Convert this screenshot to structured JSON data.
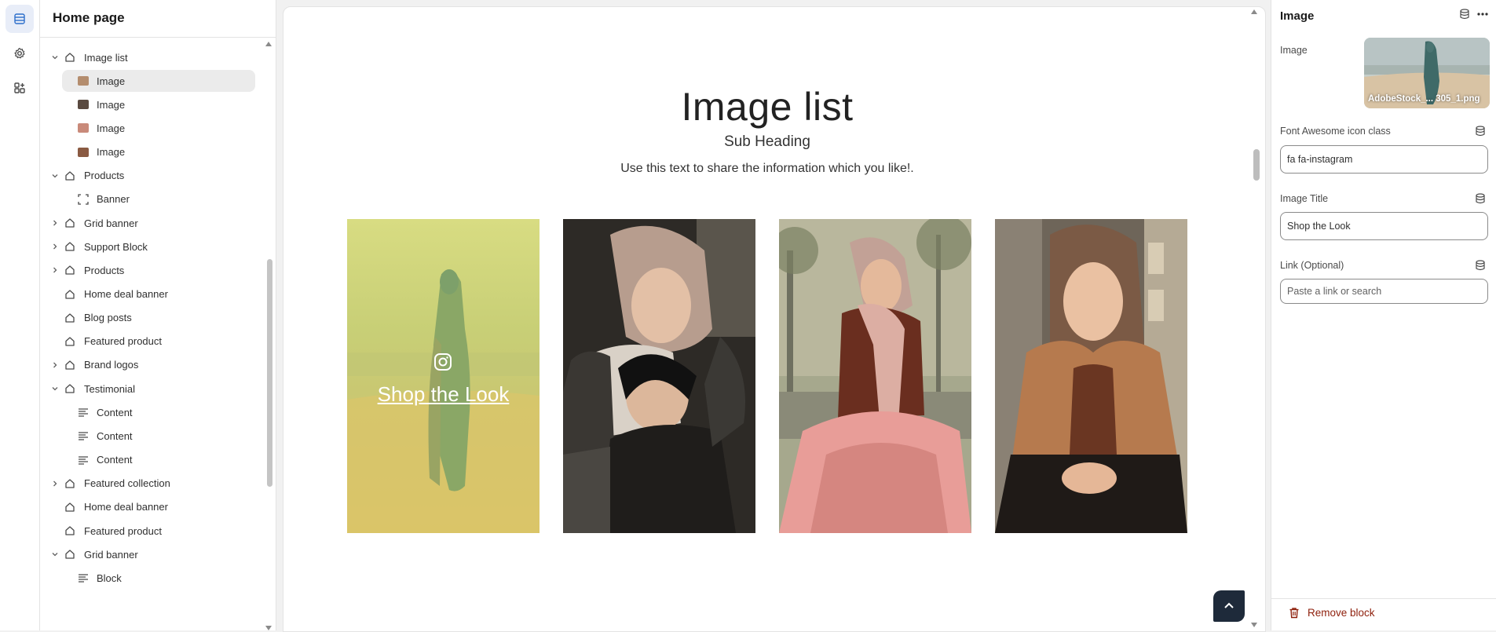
{
  "sidebar": {
    "title": "Home page",
    "items": [
      {
        "label": "Image list",
        "type": "section",
        "expanded": true
      },
      {
        "label": "Image",
        "type": "image-block",
        "selected": true
      },
      {
        "label": "Image",
        "type": "image-block"
      },
      {
        "label": "Image",
        "type": "image-block"
      },
      {
        "label": "Image",
        "type": "image-block"
      },
      {
        "label": "Products",
        "type": "section",
        "expanded": true
      },
      {
        "label": "Banner",
        "type": "banner-block"
      },
      {
        "label": "Grid banner",
        "type": "section",
        "expanded": false
      },
      {
        "label": "Support Block",
        "type": "section",
        "expanded": false
      },
      {
        "label": "Products",
        "type": "section",
        "expanded": false
      },
      {
        "label": "Home deal banner",
        "type": "section"
      },
      {
        "label": "Blog posts",
        "type": "section"
      },
      {
        "label": "Featured product",
        "type": "section"
      },
      {
        "label": "Brand logos",
        "type": "section",
        "expanded": false
      },
      {
        "label": "Testimonial",
        "type": "section",
        "expanded": true
      },
      {
        "label": "Content",
        "type": "text-block"
      },
      {
        "label": "Content",
        "type": "text-block"
      },
      {
        "label": "Content",
        "type": "text-block"
      },
      {
        "label": "Featured collection",
        "type": "section",
        "expanded": false
      },
      {
        "label": "Home deal banner",
        "type": "section"
      },
      {
        "label": "Featured product",
        "type": "section"
      },
      {
        "label": "Grid banner",
        "type": "section",
        "expanded": true
      },
      {
        "label": "Block",
        "type": "text-block"
      }
    ]
  },
  "preview": {
    "title": "Image list",
    "subheading": "Sub Heading",
    "text": "Use this text to share the information which you like!.",
    "overlay_link": "Shop the Look",
    "overlay_icon": "instagram-icon"
  },
  "panel": {
    "title": "Image",
    "image_label": "Image",
    "image_filename": "AdobeStock_... 305_1.png",
    "fa_label": "Font Awesome icon class",
    "fa_value": "fa fa-instagram",
    "title_label": "Image Title",
    "title_value": "Shop the Look",
    "link_label": "Link (Optional)",
    "link_placeholder": "Paste a link or search",
    "remove_label": "Remove block"
  },
  "colors": {
    "accent": "#2c6ecb",
    "danger": "#8e1f0b",
    "overlay_tint": "#d4d96a"
  }
}
